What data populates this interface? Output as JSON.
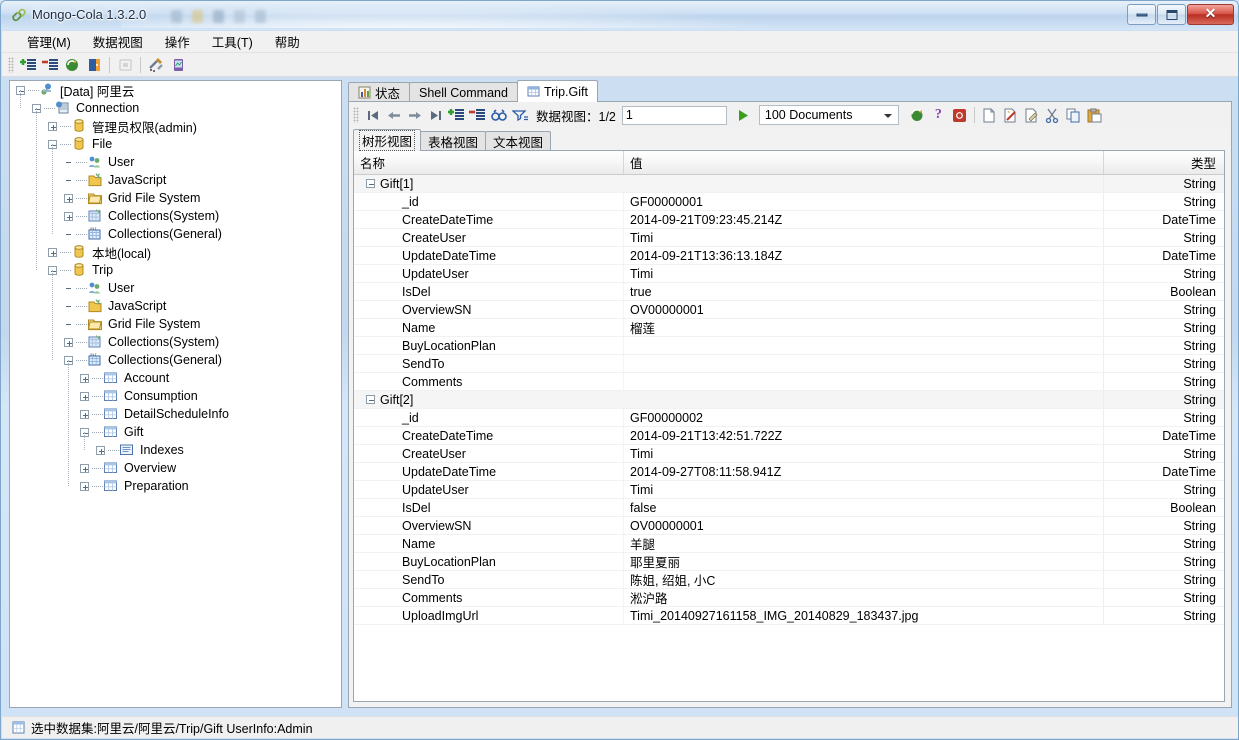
{
  "window": {
    "title": "Mongo-Cola  1.3.2.0",
    "app_icon": "link-icon",
    "controls": {
      "minimize": "Minimize",
      "maximize": "Maximize",
      "close": "Close"
    }
  },
  "menubar": {
    "items": [
      {
        "label": "管理(M)",
        "name": "menu-manage"
      },
      {
        "label": "数据视图",
        "name": "menu-dataview"
      },
      {
        "label": "操作",
        "name": "menu-operation"
      },
      {
        "label": "工具(T)",
        "name": "menu-tools"
      },
      {
        "label": "帮助",
        "name": "menu-help"
      }
    ]
  },
  "toolbar": {
    "buttons": [
      {
        "name": "add-connection-icon",
        "title": "添加连接"
      },
      {
        "name": "remove-connection-icon",
        "title": "删除连接"
      },
      {
        "name": "refresh-icon",
        "title": "刷新"
      },
      {
        "name": "import-icon",
        "title": "导入"
      },
      {
        "name": "stop-icon",
        "title": "停止"
      },
      {
        "name": "tools-icon",
        "title": "工具"
      },
      {
        "name": "monitor-icon",
        "title": "监视"
      }
    ]
  },
  "tree": {
    "nodes": [
      {
        "label": "[Data] 阿里云",
        "depth": 0,
        "expander": "minus",
        "icon": "server-icon"
      },
      {
        "label": "Connection",
        "depth": 1,
        "expander": "minus",
        "icon": "connection-icon"
      },
      {
        "label": "管理员权限(admin)",
        "depth": 2,
        "expander": "plus",
        "icon": "database-icon"
      },
      {
        "label": "File",
        "depth": 2,
        "expander": "minus",
        "icon": "database-icon"
      },
      {
        "label": "User",
        "depth": 3,
        "expander": "none",
        "icon": "users-icon"
      },
      {
        "label": "JavaScript",
        "depth": 3,
        "expander": "none",
        "icon": "javascript-icon"
      },
      {
        "label": "Grid File System",
        "depth": 3,
        "expander": "plus",
        "icon": "folder-icon"
      },
      {
        "label": "Collections(System)",
        "depth": 3,
        "expander": "plus",
        "icon": "collections-system-icon"
      },
      {
        "label": "Collections(General)",
        "depth": 3,
        "expander": "none",
        "icon": "collections-general-icon"
      },
      {
        "label": "本地(local)",
        "depth": 2,
        "expander": "plus",
        "icon": "database-icon"
      },
      {
        "label": "Trip",
        "depth": 2,
        "expander": "minus",
        "icon": "database-icon"
      },
      {
        "label": "User",
        "depth": 3,
        "expander": "none",
        "icon": "users-icon"
      },
      {
        "label": "JavaScript",
        "depth": 3,
        "expander": "none",
        "icon": "javascript-icon"
      },
      {
        "label": "Grid File System",
        "depth": 3,
        "expander": "none",
        "icon": "folder-icon"
      },
      {
        "label": "Collections(System)",
        "depth": 3,
        "expander": "plus",
        "icon": "collections-system-icon"
      },
      {
        "label": "Collections(General)",
        "depth": 3,
        "expander": "minus",
        "icon": "collections-general-icon"
      },
      {
        "label": "Account",
        "depth": 4,
        "expander": "plus",
        "icon": "table-icon"
      },
      {
        "label": "Consumption",
        "depth": 4,
        "expander": "plus",
        "icon": "table-icon"
      },
      {
        "label": "DetailScheduleInfo",
        "depth": 4,
        "expander": "plus",
        "icon": "table-icon"
      },
      {
        "label": "Gift",
        "depth": 4,
        "expander": "minus",
        "icon": "table-icon"
      },
      {
        "label": "Indexes",
        "depth": 5,
        "expander": "plus",
        "icon": "index-icon"
      },
      {
        "label": "Overview",
        "depth": 4,
        "expander": "plus",
        "icon": "table-icon"
      },
      {
        "label": "Preparation",
        "depth": 4,
        "expander": "plus",
        "icon": "table-icon"
      }
    ]
  },
  "main_tabs": [
    {
      "label": "状态",
      "icon": "chart-icon",
      "active": false,
      "name": "tab-status"
    },
    {
      "label": "Shell Command",
      "icon": "",
      "active": false,
      "name": "tab-shell-command"
    },
    {
      "label": "Trip.Gift",
      "icon": "table-icon",
      "active": true,
      "name": "tab-trip-gift"
    }
  ],
  "data_toolbar": {
    "nav": [
      {
        "name": "first-page-icon",
        "title": "第一页"
      },
      {
        "name": "previous-page-icon",
        "title": "上一页"
      },
      {
        "name": "next-page-icon",
        "title": "下一页"
      },
      {
        "name": "last-page-icon",
        "title": "最后一页"
      },
      {
        "name": "add-record-icon",
        "title": "添加"
      },
      {
        "name": "remove-record-icon",
        "title": "删除"
      },
      {
        "name": "find-icon",
        "title": "查找"
      },
      {
        "name": "filter-icon",
        "title": "筛选"
      }
    ],
    "page_label": "数据视图：1/2",
    "page_input_value": "1",
    "run_icon": "run-icon",
    "doc_count": "100  Documents",
    "right_buttons": [
      {
        "name": "globe-icon",
        "title": "刷新"
      },
      {
        "name": "help-icon",
        "title": "帮助"
      },
      {
        "name": "record-icon",
        "title": "停止"
      },
      {
        "name": "new-doc-icon",
        "title": "新建"
      },
      {
        "name": "delete-doc-icon",
        "title": "删除文档"
      },
      {
        "name": "edit-doc-icon",
        "title": "编辑文档"
      },
      {
        "name": "cut-icon",
        "title": "剪切"
      },
      {
        "name": "copy-icon",
        "title": "复制"
      },
      {
        "name": "paste-icon",
        "title": "粘贴"
      }
    ]
  },
  "view_tabs": [
    {
      "label": "树形视图",
      "active": true,
      "name": "tab-tree-view"
    },
    {
      "label": "表格视图",
      "active": false,
      "name": "tab-grid-view"
    },
    {
      "label": "文本视图",
      "active": false,
      "name": "tab-text-view"
    }
  ],
  "grid": {
    "columns": [
      "名称",
      "值",
      "类型"
    ],
    "rows": [
      {
        "name": "Gift[1]",
        "value": "",
        "type": "String",
        "group": true
      },
      {
        "name": "_id",
        "value": "GF00000001",
        "type": "String"
      },
      {
        "name": "CreateDateTime",
        "value": "2014-09-21T09:23:45.214Z",
        "type": "DateTime"
      },
      {
        "name": "CreateUser",
        "value": "Timi",
        "type": "String"
      },
      {
        "name": "UpdateDateTime",
        "value": "2014-09-21T13:36:13.184Z",
        "type": "DateTime"
      },
      {
        "name": "UpdateUser",
        "value": "Timi",
        "type": "String"
      },
      {
        "name": "IsDel",
        "value": "true",
        "type": "Boolean"
      },
      {
        "name": "OverviewSN",
        "value": "OV00000001",
        "type": "String"
      },
      {
        "name": "Name",
        "value": "榴莲",
        "type": "String"
      },
      {
        "name": "BuyLocationPlan",
        "value": "",
        "type": "String"
      },
      {
        "name": "SendTo",
        "value": "",
        "type": "String"
      },
      {
        "name": "Comments",
        "value": "",
        "type": "String"
      },
      {
        "name": "Gift[2]",
        "value": "",
        "type": "String",
        "group": true
      },
      {
        "name": "_id",
        "value": "GF00000002",
        "type": "String"
      },
      {
        "name": "CreateDateTime",
        "value": "2014-09-21T13:42:51.722Z",
        "type": "DateTime"
      },
      {
        "name": "CreateUser",
        "value": "Timi",
        "type": "String"
      },
      {
        "name": "UpdateDateTime",
        "value": "2014-09-27T08:11:58.941Z",
        "type": "DateTime"
      },
      {
        "name": "UpdateUser",
        "value": "Timi",
        "type": "String"
      },
      {
        "name": "IsDel",
        "value": "false",
        "type": "Boolean"
      },
      {
        "name": "OverviewSN",
        "value": "OV00000001",
        "type": "String"
      },
      {
        "name": "Name",
        "value": "羊腿",
        "type": "String"
      },
      {
        "name": "BuyLocationPlan",
        "value": "耶里夏丽",
        "type": "String"
      },
      {
        "name": "SendTo",
        "value": "陈姐, 绍姐, 小C",
        "type": "String"
      },
      {
        "name": "Comments",
        "value": "淞沪路",
        "type": "String"
      },
      {
        "name": "UploadImgUrl",
        "value": "Timi_20140927161158_IMG_20140829_183437.jpg",
        "type": "String"
      }
    ]
  },
  "statusbar": {
    "icon": "table-icon",
    "text": "选中数据集:阿里云/阿里云/Trip/Gift  UserInfo:Admin"
  },
  "colors": {
    "title_gradient_top": "#e8f1fa",
    "close_button": "#b82f22",
    "panel_border": "#9aa6b2",
    "group_row_bg": "#f5f5f5",
    "run_green": "#3a9e1e"
  }
}
